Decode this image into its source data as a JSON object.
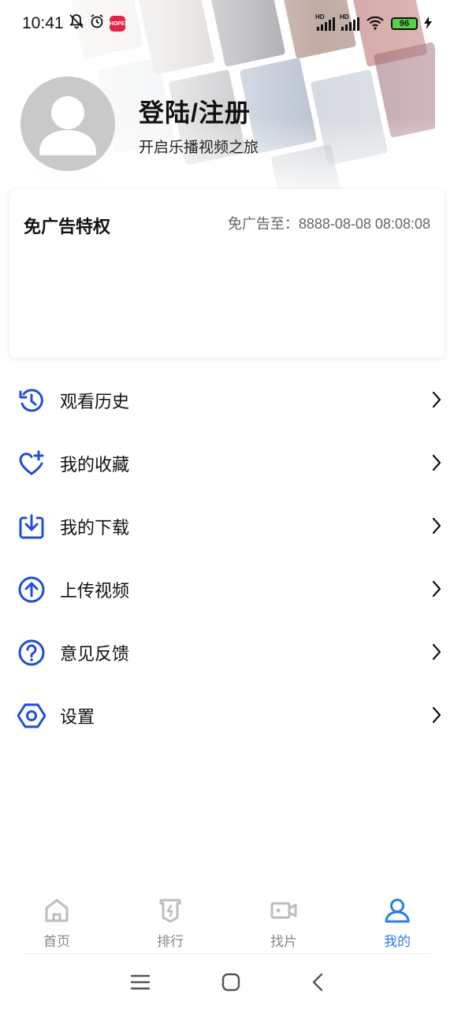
{
  "status_bar": {
    "time": "10:41",
    "app_badge": "HOPE",
    "hd_1": "HD",
    "hd_2": "HD",
    "battery": "96",
    "icons": [
      "bell-off-icon",
      "alarm-icon",
      "signal-icon",
      "wifi-icon",
      "battery-icon",
      "charging-icon"
    ]
  },
  "profile": {
    "login_title": "登陆/注册",
    "login_subtitle": "开启乐播视频之旅",
    "avatar_icon": "user-avatar-icon"
  },
  "vip": {
    "title": "免广告特权",
    "expire_text": "免广告至：8888-08-08 08:08:08"
  },
  "menu": {
    "items": [
      {
        "label": "观看历史",
        "icon": "history-icon"
      },
      {
        "label": "我的收藏",
        "icon": "heart-plus-icon"
      },
      {
        "label": "我的下载",
        "icon": "download-icon"
      },
      {
        "label": "上传视频",
        "icon": "upload-icon"
      },
      {
        "label": "意见反馈",
        "icon": "question-icon"
      },
      {
        "label": "设置",
        "icon": "settings-icon"
      }
    ]
  },
  "bottom_nav": {
    "items": [
      {
        "label": "首页",
        "icon": "home-icon"
      },
      {
        "label": "排行",
        "icon": "ranking-icon"
      },
      {
        "label": "找片",
        "icon": "video-camera-icon"
      },
      {
        "label": "我的",
        "icon": "person-icon"
      }
    ],
    "active_index": 3
  },
  "colors": {
    "accent": "#2b7fe8",
    "icon_blue": "#1f4fd6",
    "inactive": "#888888",
    "avatar_bg": "#c9c9c9"
  }
}
